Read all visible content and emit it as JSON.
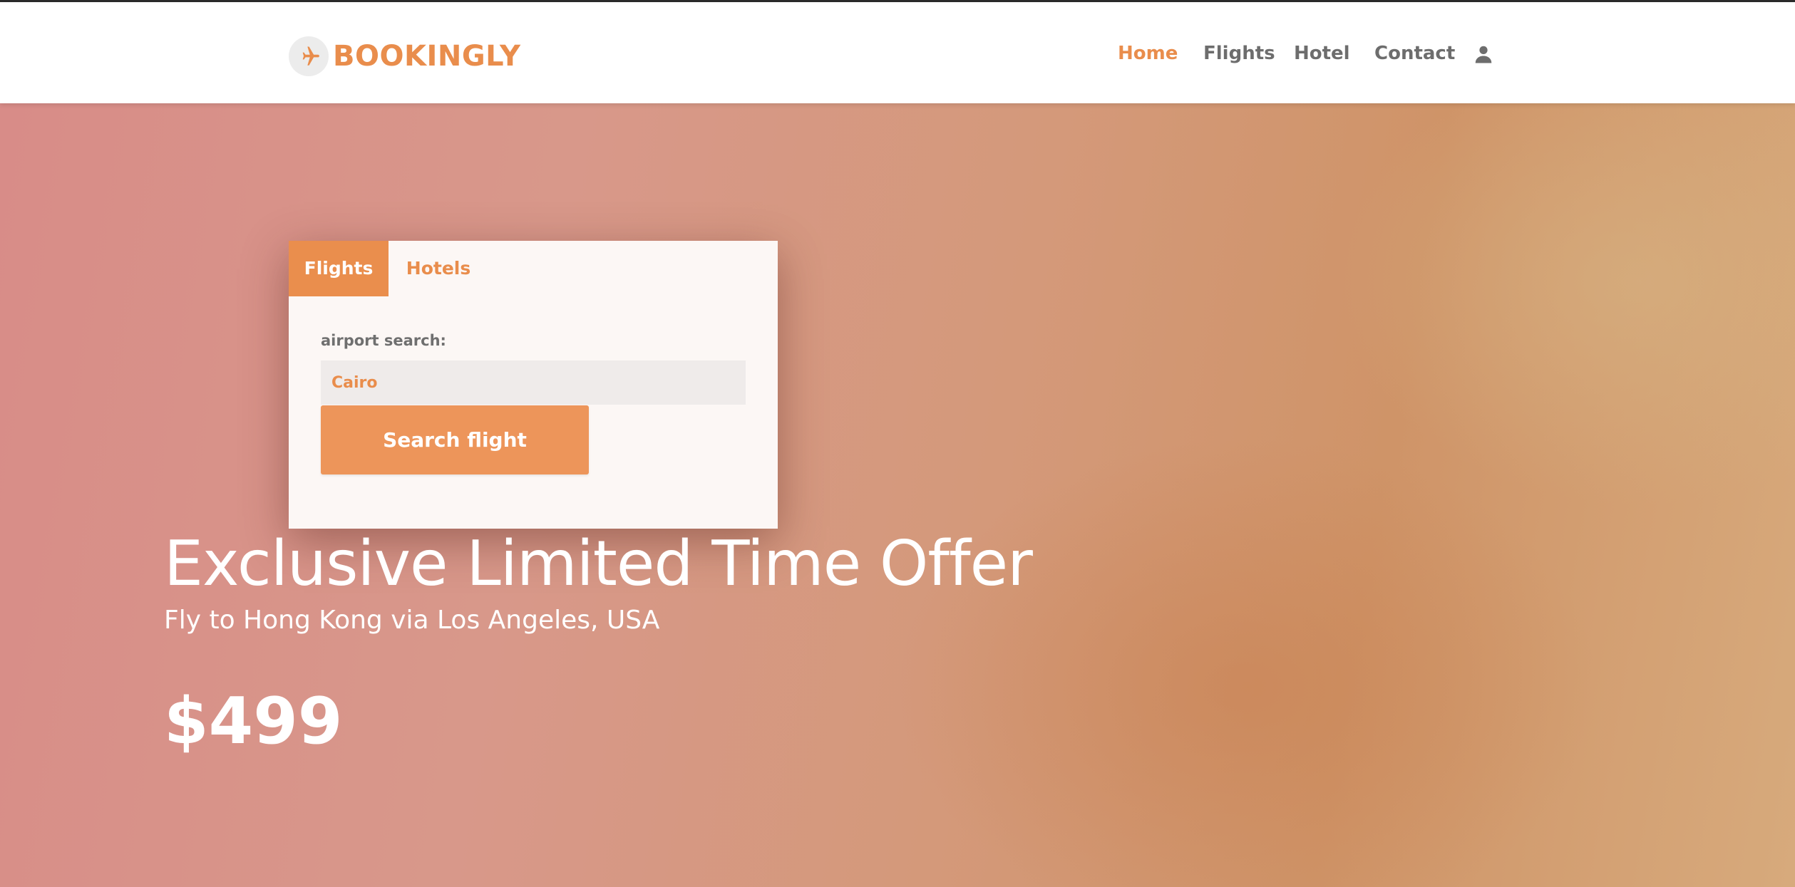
{
  "brand": {
    "name": "BOOKINGLY",
    "logo_icon": "airplane-icon"
  },
  "nav": {
    "items": [
      {
        "label": "Home",
        "active": true
      },
      {
        "label": "Flights",
        "active": false
      },
      {
        "label": "Hotel",
        "active": false
      },
      {
        "label": "Contact",
        "active": false
      }
    ],
    "user_icon": "user-icon"
  },
  "search": {
    "tabs": [
      {
        "label": "Flights",
        "active": true
      },
      {
        "label": "Hotels",
        "active": false
      }
    ],
    "field_label": "airport search:",
    "field_value": "Cairo",
    "button_label": "Search flight"
  },
  "offer": {
    "title": "Exclusive Limited Time Offer",
    "subtitle": "Fly to Hong Kong via Los Angeles, USA",
    "price": "$499"
  },
  "colors": {
    "accent": "#e98d4c",
    "nav_text": "#6d6d6d",
    "hero_start": "#d88c88",
    "hero_end": "#d7aa7c"
  }
}
